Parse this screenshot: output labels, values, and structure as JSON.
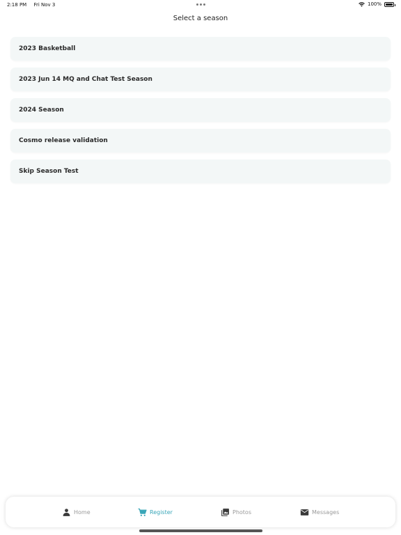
{
  "status_bar": {
    "time": "2:18 PM",
    "date": "Fri Nov 3",
    "battery": "100%",
    "battery_level": 1.0
  },
  "page": {
    "title": "Select a season"
  },
  "seasons": [
    {
      "label": "2023 Basketball"
    },
    {
      "label": "2023 Jun 14 MQ and Chat Test Season"
    },
    {
      "label": "2024 Season"
    },
    {
      "label": "Cosmo release validation"
    },
    {
      "label": "Skip Season Test"
    }
  ],
  "tabs": [
    {
      "label": "Home",
      "icon": "person-icon",
      "active": false
    },
    {
      "label": "Register",
      "icon": "cart-icon",
      "active": true
    },
    {
      "label": "Photos",
      "icon": "photos-icon",
      "active": false
    },
    {
      "label": "Messages",
      "icon": "envelope-icon",
      "active": false
    }
  ],
  "colors": {
    "accent": "#3aa6b8",
    "inactive": "#9a9a9a",
    "item_bg": "#f3f7f7"
  }
}
